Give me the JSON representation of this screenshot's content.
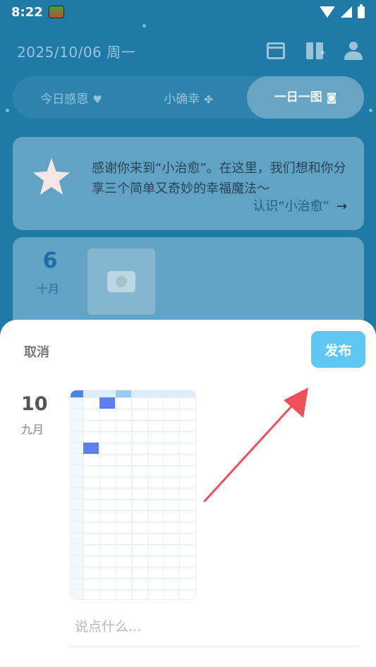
{
  "status_bar": {
    "time": "8:22"
  },
  "header": {
    "date": "2025/10/06 周一"
  },
  "tabs": [
    {
      "label": "今日感恩",
      "glyph": "♥"
    },
    {
      "label": "小确幸",
      "glyph": "✤"
    },
    {
      "label": "一日一图",
      "glyph": "◙"
    }
  ],
  "intro_card": {
    "text": "感谢你来到“小治愈”。在这里，我们想和你分享三个简单又奇妙的幸福魔法～",
    "link_label": "认识“小治愈”",
    "link_arrow": "→"
  },
  "entry_card": {
    "day": "6",
    "month": "十月"
  },
  "sheet": {
    "cancel_label": "取消",
    "publish_label": "发布",
    "day": "10",
    "month": "九月",
    "comment_placeholder": "说点什么..."
  },
  "colors": {
    "accent": "#5ec8f2",
    "background": "#1f7aa8",
    "arrow": "#f0505a"
  },
  "icons": [
    "calendar-icon",
    "gift-icon",
    "user-icon",
    "camera-icon",
    "wifi-icon",
    "signal-icon",
    "battery-icon"
  ]
}
